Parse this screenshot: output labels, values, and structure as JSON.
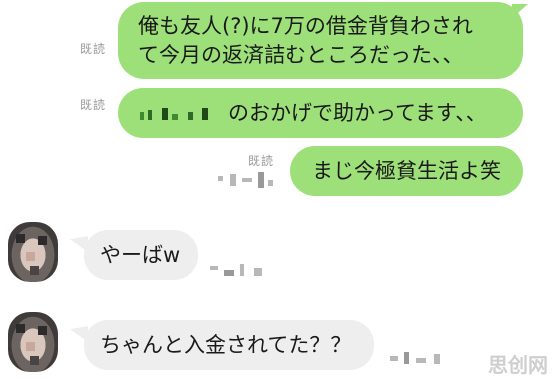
{
  "messages": [
    {
      "side": "out",
      "read_label": "既読",
      "lines": [
        "俺も友人(?)に7万の借金背負わされ",
        "て今月の返済詰むところだった、、"
      ]
    },
    {
      "side": "out",
      "read_label": "既読",
      "text": "のおかげで助かってます、、"
    },
    {
      "side": "out",
      "read_label": "既読",
      "text": "まじ今極貧生活よ笑"
    },
    {
      "side": "in",
      "text": "やーばw"
    },
    {
      "side": "in",
      "text": "ちゃんと入金されてた？？"
    }
  ],
  "watermark": "思创网",
  "colors": {
    "outgoing_bubble": "#9de07a",
    "incoming_bubble": "#eeeeee",
    "read_label": "#9a9a9a"
  }
}
